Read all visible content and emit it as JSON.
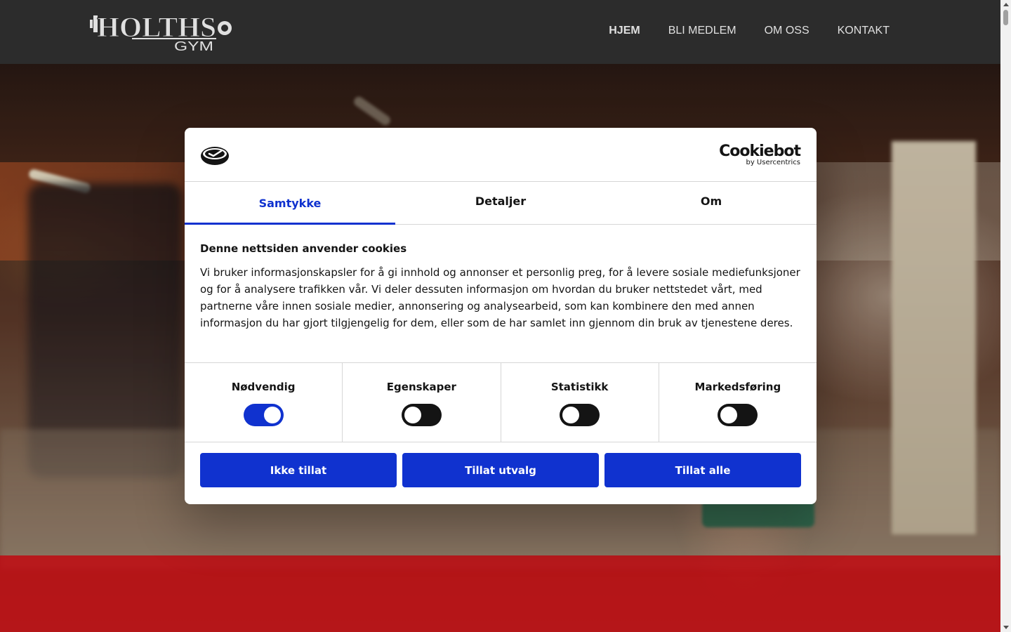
{
  "header": {
    "logo_alt": "Holths Gym",
    "logo_text_main": "HOLTHS",
    "logo_text_sub": "GYM",
    "nav": [
      {
        "label": "HJEM",
        "active": true
      },
      {
        "label": "BLI MEDLEM",
        "active": false
      },
      {
        "label": "OM OSS",
        "active": false
      },
      {
        "label": "KONTAKT",
        "active": false
      }
    ]
  },
  "cookie_dialog": {
    "brand": {
      "name": "Cookiebot",
      "by": "by Usercentrics"
    },
    "tabs": [
      {
        "label": "Samtykke",
        "active": true
      },
      {
        "label": "Detaljer",
        "active": false
      },
      {
        "label": "Om",
        "active": false
      }
    ],
    "heading": "Denne nettsiden anvender cookies",
    "body": "Vi bruker informasjonskapsler for å gi innhold og annonser et personlig preg, for å levere sosiale mediefunksjoner og for å analysere trafikken vår. Vi deler dessuten informasjon om hvordan du bruker nettstedet vårt, med partnerne våre innen sosiale medier, annonsering og analysearbeid, som kan kombinere den med annen informasjon du har gjort tilgjengelig for dem, eller som de har samlet inn gjennom din bruk av tjenestene deres.",
    "toggles": [
      {
        "label": "Nødvendig",
        "on": true
      },
      {
        "label": "Egenskaper",
        "on": false
      },
      {
        "label": "Statistikk",
        "on": false
      },
      {
        "label": "Markedsføring",
        "on": false
      }
    ],
    "buttons": {
      "deny": "Ikke tillat",
      "allow_selection": "Tillat utvalg",
      "allow_all": "Tillat alle"
    }
  },
  "colors": {
    "header_bg": "#333333",
    "accent_blue": "#1032cf",
    "hero_red": "#e1000a"
  }
}
